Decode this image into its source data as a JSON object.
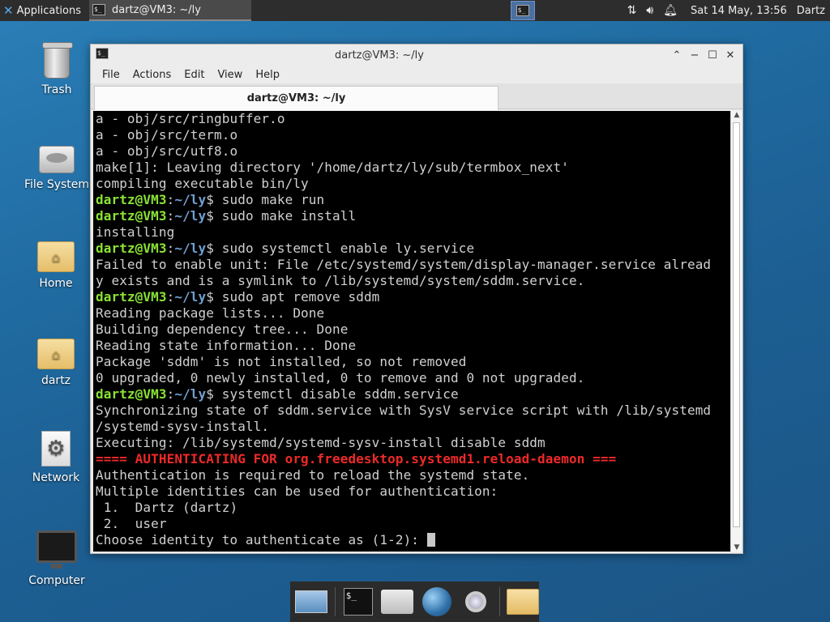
{
  "panel": {
    "apps_label": "Applications",
    "task_title": "dartz@VM3: ~/ly",
    "clock": "Sat 14 May, 13:56",
    "user": "Dartz",
    "tray_icons": [
      "network-icon",
      "volume-icon",
      "notification-bell-icon"
    ]
  },
  "desktop": {
    "icons": [
      {
        "label": "Trash",
        "icon": "trash-icon"
      },
      {
        "label": "File System",
        "icon": "drive-icon"
      },
      {
        "label": "Home",
        "icon": "home-folder-icon"
      },
      {
        "label": "dartz",
        "icon": "home-folder-icon"
      },
      {
        "label": "Network",
        "icon": "network-icon"
      },
      {
        "label": "Computer",
        "icon": "monitor-icon"
      }
    ]
  },
  "window": {
    "title": "dartz@VM3: ~/ly",
    "menu": [
      "File",
      "Actions",
      "Edit",
      "View",
      "Help"
    ],
    "tab_title": "dartz@VM3: ~/ly"
  },
  "terminal": {
    "prompt_user": "dartz@VM3",
    "prompt_path": "~/ly",
    "lines": [
      "a - obj/src/ringbuffer.o",
      "a - obj/src/term.o",
      "a - obj/src/utf8.o",
      "make[1]: Leaving directory '/home/dartz/ly/sub/termbox_next'",
      "compiling executable bin/ly",
      "sudo make run",
      "sudo make install",
      "installing",
      "sudo systemctl enable ly.service",
      "Failed to enable unit: File /etc/systemd/system/display-manager.service alread",
      "y exists and is a symlink to /lib/systemd/system/sddm.service.",
      "sudo apt remove sddm",
      "Reading package lists... Done",
      "Building dependency tree... Done",
      "Reading state information... Done",
      "Package 'sddm' is not installed, so not removed",
      "0 upgraded, 0 newly installed, 0 to remove and 0 not upgraded.",
      "systemctl disable sddm.service",
      "Synchronizing state of sddm.service with SysV service script with /lib/systemd",
      "/systemd-sysv-install.",
      "Executing: /lib/systemd/systemd-sysv-install disable sddm",
      "==== AUTHENTICATING FOR org.freedesktop.systemd1.reload-daemon ===",
      "Authentication is required to reload the systemd state.",
      "Multiple identities can be used for authentication:",
      " 1.  Dartz (dartz)",
      " 2.  user",
      "Choose identity to authenticate as (1-2): "
    ]
  },
  "dock": {
    "items": [
      "show-desktop-icon",
      "terminal-icon",
      "home-folder-icon",
      "web-browser-icon",
      "search-icon",
      "folder-icon"
    ]
  }
}
